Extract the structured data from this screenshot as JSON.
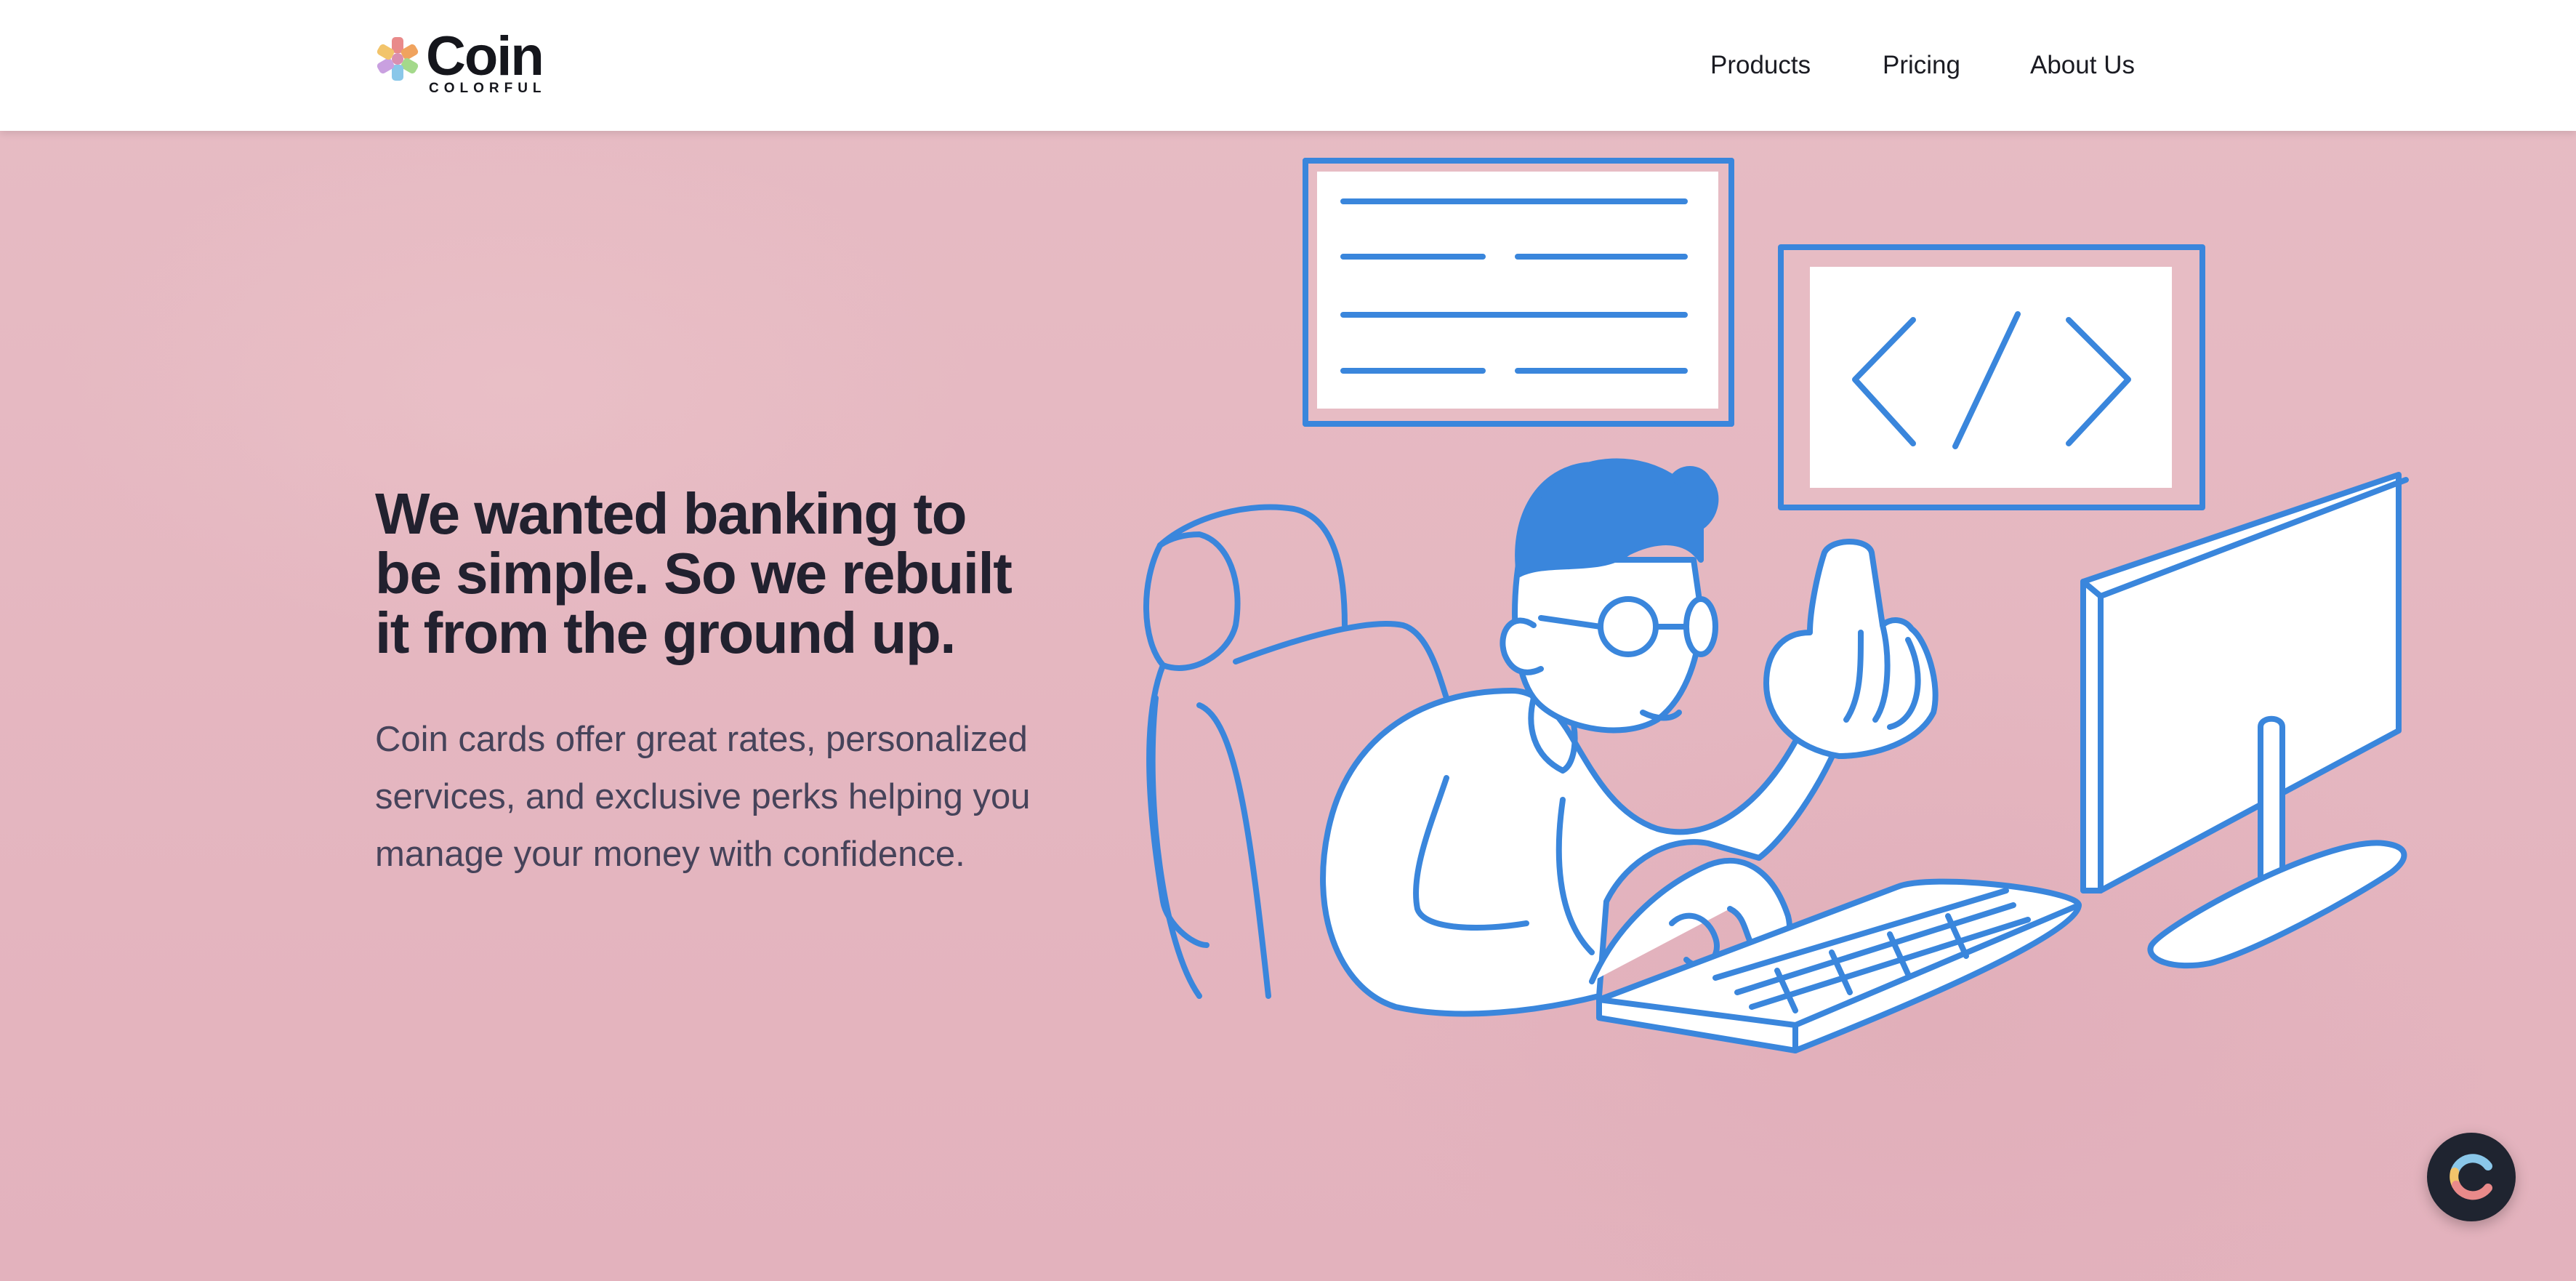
{
  "brand": {
    "name": "Coin",
    "tagline": "COLORFUL",
    "logo_icon": "colorful-flower-icon",
    "logo_colors": [
      "#e98a8a",
      "#8ac7e9",
      "#a4d98b",
      "#c9a0e0",
      "#f2c46b",
      "#f0a35e"
    ]
  },
  "nav": {
    "items": [
      {
        "label": "Products"
      },
      {
        "label": "Pricing"
      },
      {
        "label": "About Us"
      }
    ]
  },
  "hero": {
    "headline": "We wanted banking to be simple. So we rebuilt it from the ground up.",
    "description": "Coin cards offer great rates, personalized services, and exclusive perks helping you manage your money with confidence.",
    "illustration": "person-typing-at-computer-illustration",
    "background_color": "#e4b5bf",
    "illustration_stroke_color": "#3a86dc"
  },
  "chat_widget": {
    "icon": "coin-c-logo-icon",
    "background_color": "#1f2430"
  }
}
